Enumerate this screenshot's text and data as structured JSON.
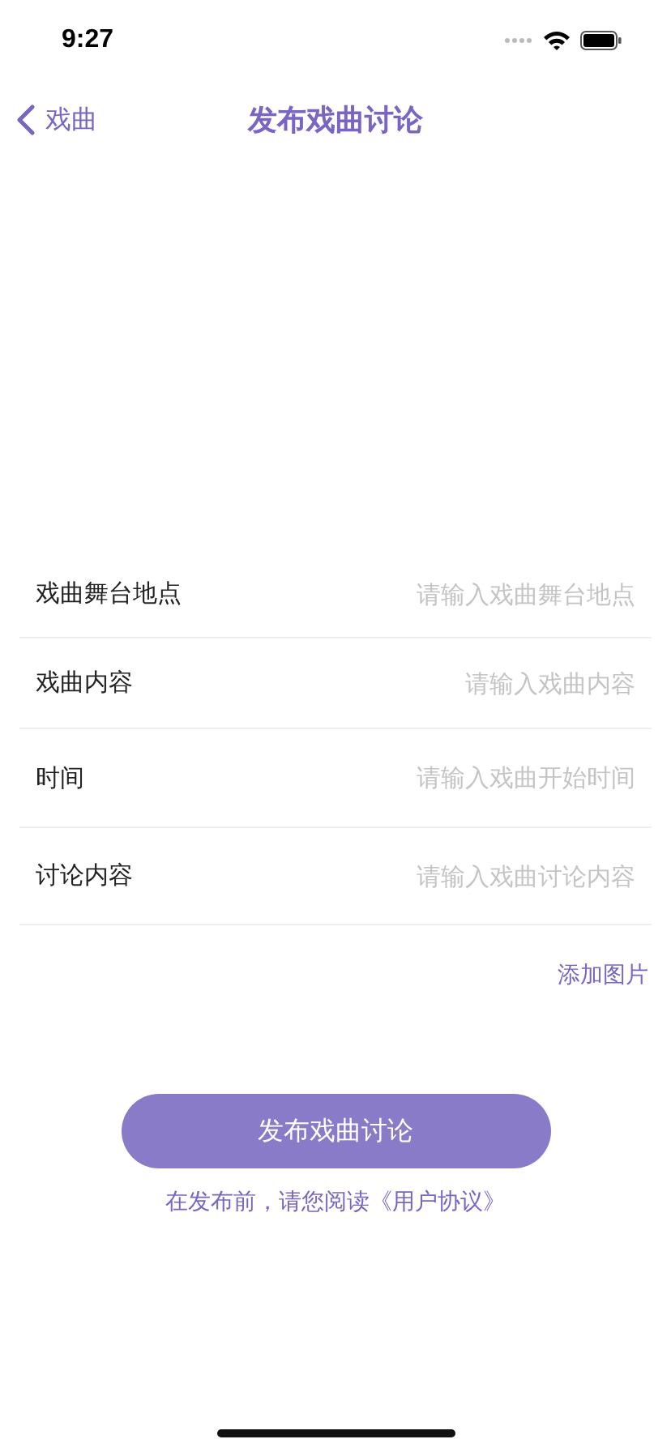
{
  "status_bar": {
    "time": "9:27"
  },
  "nav": {
    "back_label": "戏曲",
    "title": "发布戏曲讨论"
  },
  "fields": [
    {
      "label": "戏曲舞台地点",
      "placeholder": "请输入戏曲舞台地点"
    },
    {
      "label": "戏曲内容",
      "placeholder": "请输入戏曲内容"
    },
    {
      "label": "时间",
      "placeholder": "请输入戏曲开始时间"
    },
    {
      "label": "讨论内容",
      "placeholder": "请输入戏曲讨论内容"
    }
  ],
  "add_image": "添加图片",
  "submit_button": "发布戏曲讨论",
  "agreement": "在发布前，请您阅读《用户协议》"
}
